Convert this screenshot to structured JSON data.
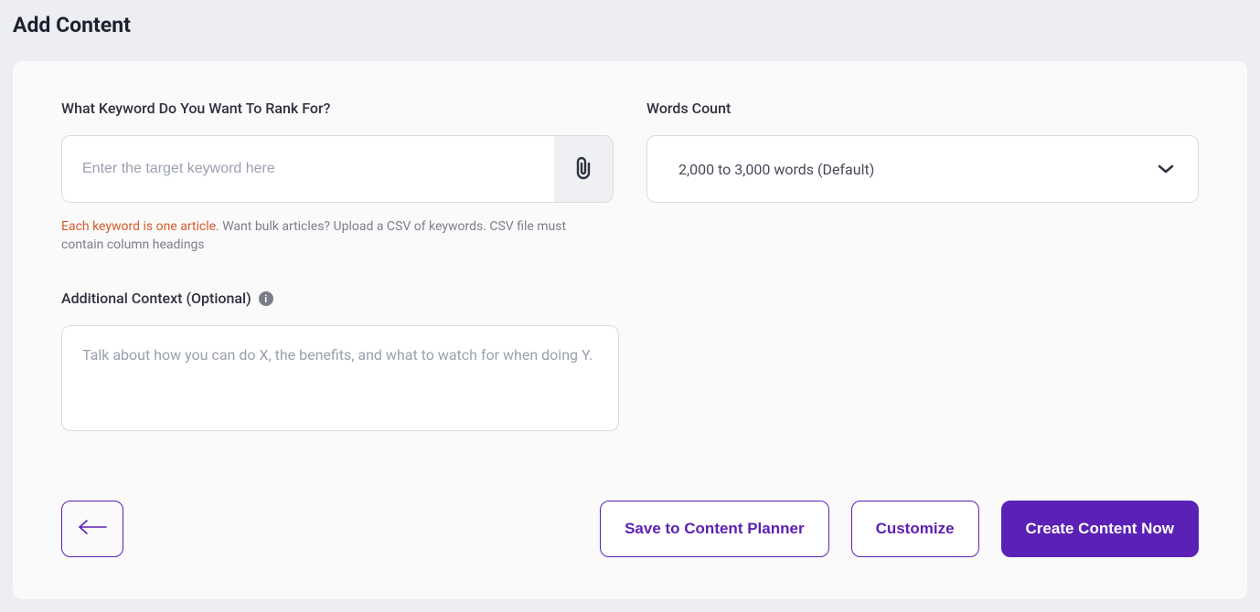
{
  "page": {
    "title": "Add Content"
  },
  "form": {
    "keyword": {
      "label": "What Keyword Do You Want To Rank For?",
      "placeholder": "Enter the target keyword here",
      "attach_icon": "paperclip-icon",
      "help_accent": "Each keyword is one article.",
      "help_rest": " Want bulk articles? Upload a CSV of keywords. CSV file must contain column headings"
    },
    "words_count": {
      "label": "Words Count",
      "selected": "2,000 to 3,000 words (Default)"
    },
    "context": {
      "label": "Additional Context (Optional)",
      "placeholder": "Talk about how you can do X, the benefits, and what to watch for when doing Y."
    }
  },
  "footer": {
    "save_label": "Save to Content Planner",
    "customize_label": "Customize",
    "create_label": "Create Content Now"
  }
}
